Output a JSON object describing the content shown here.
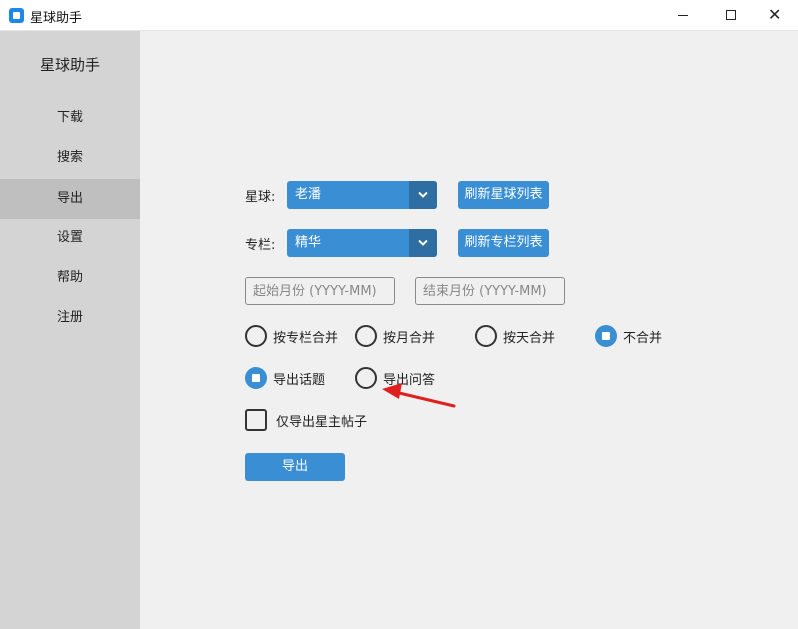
{
  "window": {
    "title": "星球助手",
    "controls": [
      "minimize-icon",
      "maximize-icon",
      "close-icon"
    ],
    "close_glyph": "✕"
  },
  "sidebar": {
    "title": "星球助手",
    "items": [
      {
        "label": "下载",
        "active": false
      },
      {
        "label": "搜索",
        "active": false
      },
      {
        "label": "导出",
        "active": true
      },
      {
        "label": "设置",
        "active": false
      },
      {
        "label": "帮助",
        "active": false
      },
      {
        "label": "注册",
        "active": false
      }
    ]
  },
  "form": {
    "planet_label": "星球:",
    "planet_value": "老潘",
    "refresh_planets": "刷新星球列表",
    "column_label": "专栏:",
    "column_value": "精华",
    "refresh_columns": "刷新专栏列表",
    "start_month_placeholder": "起始月份 (YYYY-MM)",
    "end_month_placeholder": "结束月份 (YYYY-MM)",
    "merge_options": [
      {
        "label": "按专栏合并",
        "checked": false
      },
      {
        "label": "按月合并",
        "checked": false
      },
      {
        "label": "按天合并",
        "checked": false
      },
      {
        "label": "不合并",
        "checked": true
      }
    ],
    "export_type_options": [
      {
        "label": "导出话题",
        "checked": true
      },
      {
        "label": "导出问答",
        "checked": false
      }
    ],
    "owner_only_label": "仅导出星主帖子",
    "owner_only_checked": false,
    "export_button": "导出"
  },
  "colors": {
    "accent": "#3a8ed4",
    "accent_dark": "#2f6ea3",
    "sidebar_bg": "#d4d4d4",
    "sidebar_active": "#bfbfbf",
    "main_bg": "#f0f0f0",
    "annotation_arrow": "#e02020"
  }
}
